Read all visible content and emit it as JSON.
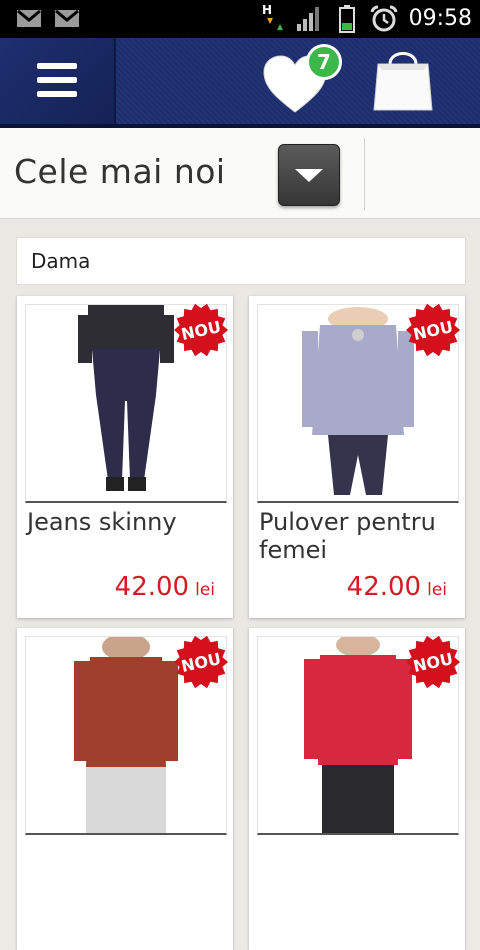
{
  "status_bar": {
    "time": "09:58",
    "network_label": "H"
  },
  "header": {
    "favorites_count": "7"
  },
  "title_bar": {
    "title": "Cele mai noi"
  },
  "category": {
    "label": "Dama"
  },
  "products": [
    {
      "name": "Jeans skinny",
      "price": "42.00",
      "currency": "lei",
      "badge": "NOU",
      "top_color": "#2d2d33",
      "bottom_color": "#2e2c4a"
    },
    {
      "name": "Pulover pentru femei",
      "price": "42.00",
      "currency": "lei",
      "badge": "NOU",
      "top_color": "#a9a9c9",
      "bottom_color": "#35344c"
    },
    {
      "name": "",
      "price": "",
      "currency": "",
      "badge": "NOU",
      "top_color": "#a0402c",
      "bottom_color": "#d9d9d9"
    },
    {
      "name": "",
      "price": "",
      "currency": "",
      "badge": "NOU",
      "top_color": "#d8283f",
      "bottom_color": "#2a2a2e"
    }
  ],
  "colors": {
    "header_blue": "#1b2a63",
    "price_red": "#d61a24",
    "badge_red": "#d4101c",
    "favorites_green": "#3cb84a"
  }
}
